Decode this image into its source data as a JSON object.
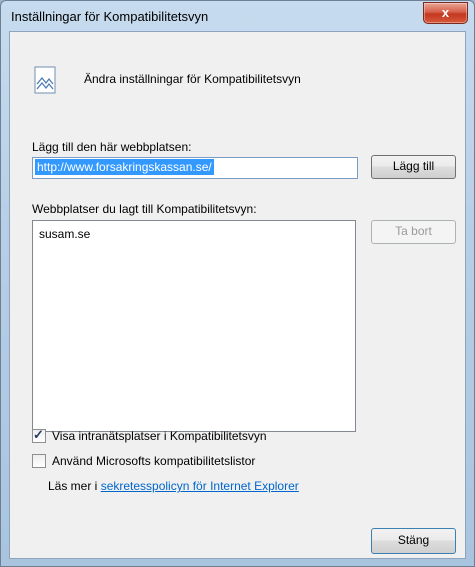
{
  "window": {
    "title": "Inställningar för Kompatibilitetsvyn",
    "close_glyph": "x"
  },
  "header": {
    "icon": "compatibility-view-icon",
    "text": "Ändra inställningar för Kompatibilitetsvyn"
  },
  "add_site": {
    "label": "Lägg till den här webbplatsen:",
    "value": "http://www.forsakringskassan.se/",
    "button_label": "Lägg till"
  },
  "site_list": {
    "label": "Webbplatser du lagt till Kompatibilitetsvyn:",
    "items": [
      "susam.se"
    ],
    "remove_label": "Ta bort"
  },
  "options": {
    "intranet_label": "Visa intranätsplatser i Kompatibilitetsvyn",
    "intranet_checked": true,
    "ms_lists_label": "Använd Microsofts kompatibilitetslistor",
    "ms_lists_checked": false
  },
  "more_info": {
    "prefix": "Läs mer i ",
    "link_text": "sekretesspolicyn för Internet Explorer"
  },
  "footer": {
    "close_label": "Stäng"
  }
}
